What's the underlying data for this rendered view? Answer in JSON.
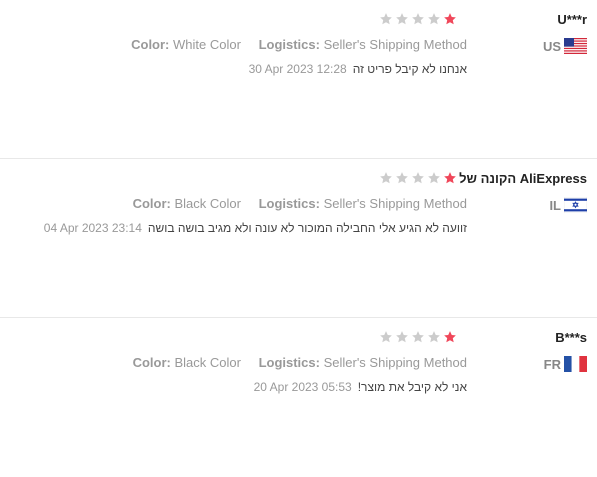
{
  "colors": {
    "star_filled": "#f0475a",
    "star_empty": "#cccccc",
    "text": "#333333",
    "muted": "#999999"
  },
  "reviews": [
    {
      "user": "U***r",
      "country_code": "US",
      "flag_icon": "us-flag-icon",
      "rating": 1,
      "color_label": "Color:",
      "color_value": "White Color",
      "logistics_label": "Logistics:",
      "logistics_value": "Seller's Shipping Method",
      "text": "אנחנו לא קיבל פריט זה",
      "date": "30 Apr 2023 12:28"
    },
    {
      "user": "AliExpress הקונה של",
      "country_code": "IL",
      "flag_icon": "il-flag-icon",
      "rating": 1,
      "color_label": "Color:",
      "color_value": "Black Color",
      "logistics_label": "Logistics:",
      "logistics_value": "Seller's Shipping Method",
      "text": "זוועה לא הגיע אלי החבילה המוכור לא עונה ולא מגיב בושה בושה",
      "date": "04 Apr 2023 23:14"
    },
    {
      "user": "B***s",
      "country_code": "FR",
      "flag_icon": "fr-flag-icon",
      "rating": 1,
      "color_label": "Color:",
      "color_value": "Black Color",
      "logistics_label": "Logistics:",
      "logistics_value": "Seller's Shipping Method",
      "text": "אני לא קיבל את מוצר!",
      "date": "20 Apr 2023 05:53"
    }
  ]
}
